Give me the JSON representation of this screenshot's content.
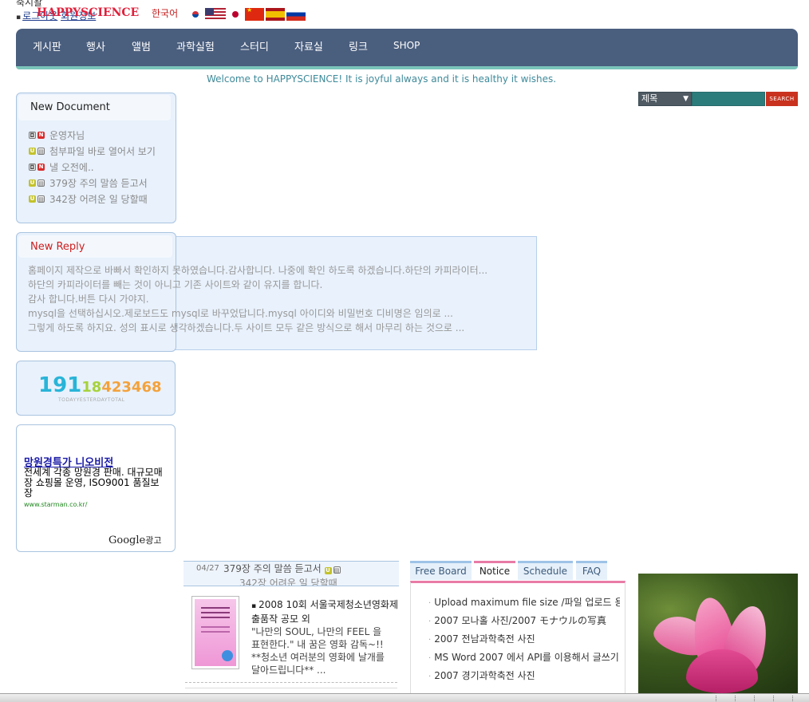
{
  "header": {
    "top_text": "축시왈",
    "logo": "HAPPYSCIENCE",
    "login_label": "로그아웃",
    "signup_label": "회원정보",
    "language_label": "한국어",
    "flags": [
      "korea-flag-icon",
      "usa-flag-icon",
      "japan-flag-icon",
      "china-flag-icon",
      "spain-flag-icon",
      "russia-flag-icon"
    ]
  },
  "nav": {
    "items": [
      "게시판",
      "행사",
      "앨범",
      "과학실험",
      "스터디",
      "자료실",
      "링크",
      "SHOP"
    ]
  },
  "welcome": "Welcome to HAPPYSCIENCE! It is joyful always and it is healthy it wishes.",
  "search": {
    "selected": "제목",
    "button": "SEARCH",
    "value": ""
  },
  "new_document": {
    "title": "New Document",
    "items": [
      {
        "icons": [
          "lock",
          "N"
        ],
        "text": "운영자님"
      },
      {
        "icons": [
          "U",
          "file"
        ],
        "text": "첨부파일 바로 열어서 보기"
      },
      {
        "icons": [
          "lock",
          "N"
        ],
        "text": "낼 오전에.."
      },
      {
        "icons": [
          "U",
          "file"
        ],
        "text": "379장 주의 말씀 듣고서"
      },
      {
        "icons": [
          "U",
          "file"
        ],
        "text": "342장 어려운 일 당할때"
      }
    ]
  },
  "new_reply": {
    "title": "New Reply",
    "items": [
      "홈페이지 제작으로 바빠서 확인하지 못하였습니다.감사합니다. 나중에 확인 하도록 하겠습니다.하단의 카피라이터...",
      "하단의 카피라이터를 빼는 것이 아니고 기존 사이트와 같이 유지를  합니다.",
      "감사 합니다.버튼 다시 가야지.",
      "mysql을 선택하십시오.제로보드도 mysql로 바꾸었답니다.mysql 아이디와 비밀번호 디비명은 임의로 ...",
      "그렇게 하도록 하지요. 성의 표시로 생각하겠습니다.두 사이트 모두 같은 방식으로 해서 마무리 하는 것으로 ..."
    ]
  },
  "counter": {
    "today": "191",
    "yesterday": "18",
    "total": "423468",
    "labels": "TODAYYESTERDAYTOTAL"
  },
  "ad": {
    "title": "망원경특가 니오비전",
    "desc": "전세계 각종 망원경 판매. 대규모매장 쇼핑몰 운영, ISO9001 품질보장",
    "url": "www.starman.co.kr/",
    "provider": "Google",
    "provider_suffix": "광고"
  },
  "recent": {
    "date": "04/27",
    "title": "379장 주의 말씀 듣고서",
    "next": "342장 어려운 일 당할때"
  },
  "news": {
    "title": "2008 10회 서울국제청소년영화제 출품작 공모 외",
    "body": "\"나만의 SOUL, 나만의 FEEL 을 표현한다.\" 내 꿈은 영화 감독~!! **청소년 여러분의 영화에 날개를 달아드립니다**    ..."
  },
  "tabs": {
    "items": [
      "Free Board",
      "Notice",
      "Schedule",
      "FAQ"
    ],
    "active": "Notice"
  },
  "notice": {
    "items": [
      "Upload maximum file size /파일 업로드 용",
      "2007 모나홀 사진/2007 モナウルの写真",
      "2007 전남과학축전 사진",
      "MS Word 2007 에서 API를 이용해서 글쓰기",
      "2007 경기과학축전 사진"
    ]
  },
  "photo": {
    "icon": "pink-flower-photo"
  }
}
